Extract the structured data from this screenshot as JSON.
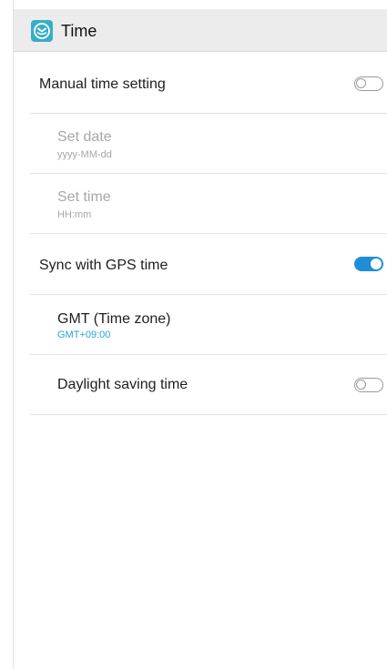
{
  "header": {
    "title": "Time",
    "icon": "time-app-icon",
    "icon_color": "#37aec5"
  },
  "settings": {
    "manual_time": {
      "label": "Manual time setting",
      "enabled": false
    },
    "set_date": {
      "label": "Set date",
      "format": "yyyy-MM-dd",
      "disabled": true
    },
    "set_time": {
      "label": "Set time",
      "format": "HH:mm",
      "disabled": true
    },
    "gps_sync": {
      "label": "Sync with GPS time",
      "enabled": true
    },
    "time_zone": {
      "label": "GMT (Time zone)",
      "value": "GMT+09:00"
    },
    "daylight_saving": {
      "label": "Daylight saving time",
      "enabled": false
    }
  },
  "colors": {
    "accent": "#1e8fd6",
    "accent_text": "#28a3d8",
    "disabled_text": "#a7a7a7",
    "header_bg": "#ececec"
  }
}
